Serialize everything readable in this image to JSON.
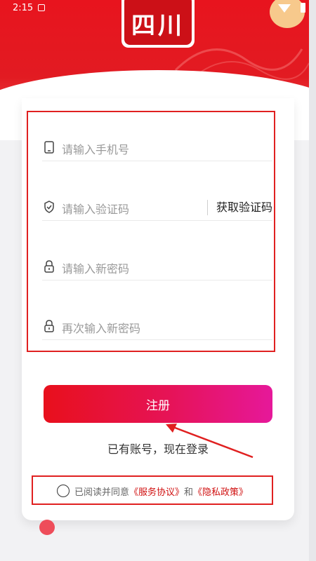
{
  "status_bar": {
    "time": "2:15"
  },
  "logo": {
    "text": "四川"
  },
  "form": {
    "phone_placeholder": "请输入手机号",
    "code_placeholder": "请输入验证码",
    "get_code_label": "获取验证码",
    "new_password_placeholder": "请输入新密码",
    "confirm_password_placeholder": "再次输入新密码"
  },
  "actions": {
    "register_label": "注册",
    "login_link": "已有账号，现在登录"
  },
  "agreement": {
    "prefix": "已阅读并同意",
    "service_label": "《服务协议》",
    "and": "和",
    "privacy_label": "《隐私政策》"
  },
  "colors": {
    "brand_red": "#e8141e",
    "button_gradient_end": "#e6189a",
    "annotation_red": "#e02020"
  }
}
